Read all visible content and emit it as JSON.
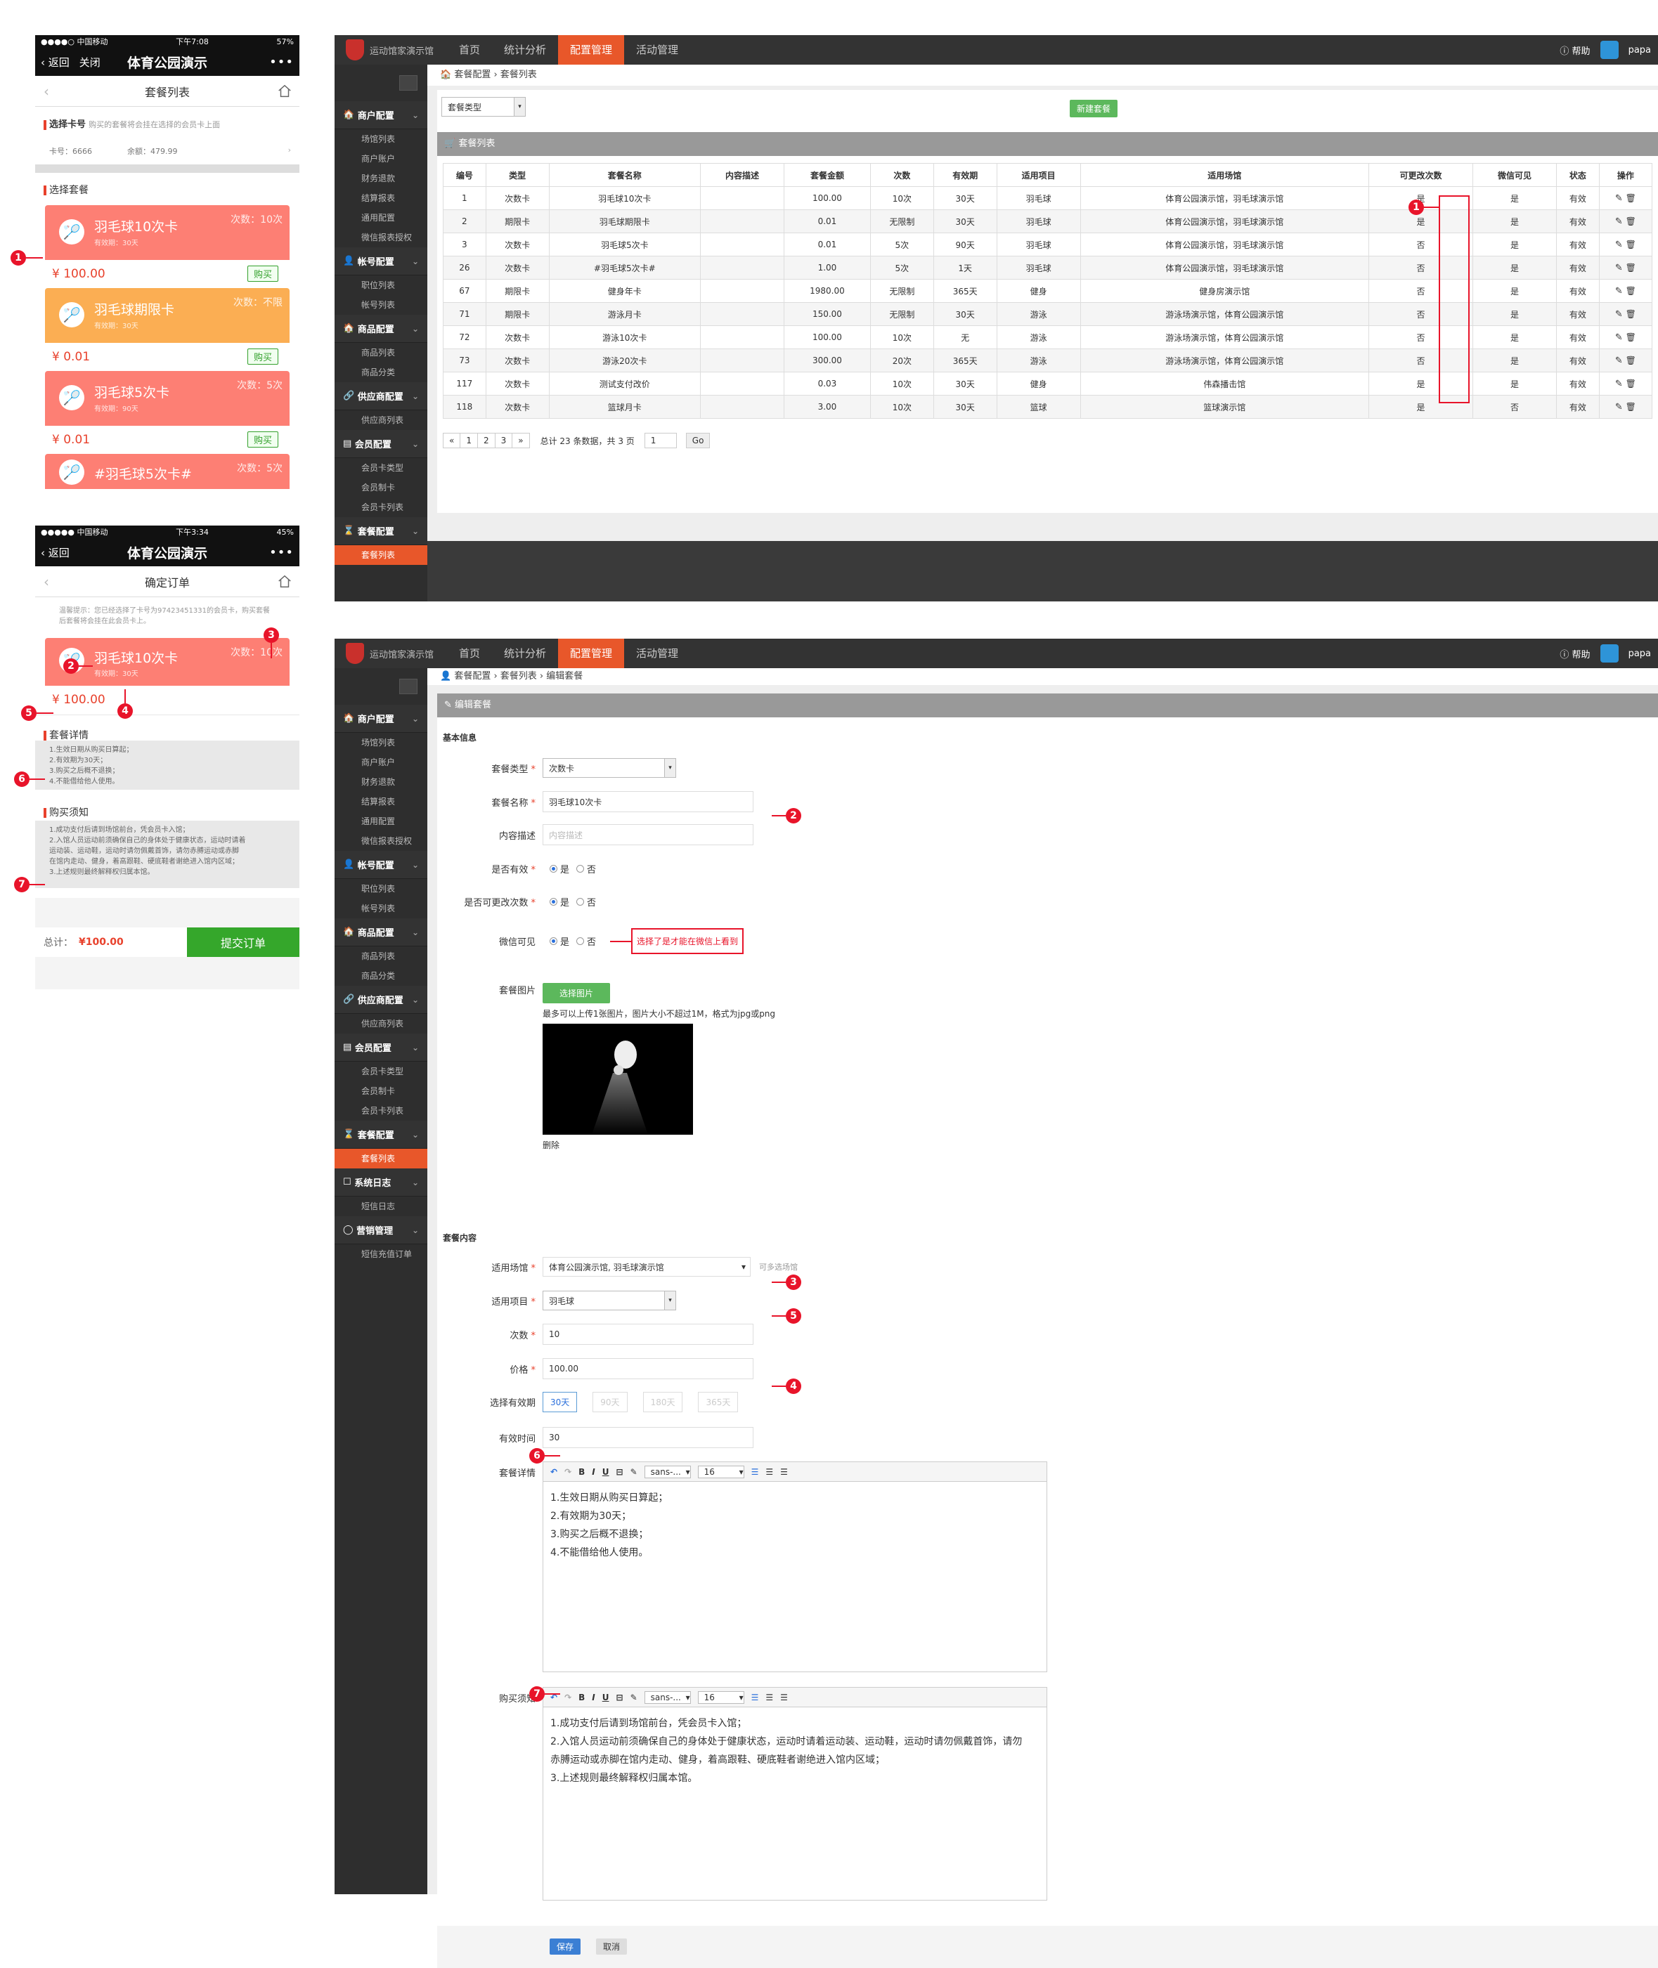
{
  "phone1": {
    "carrier": "●●●●○ 中国移动",
    "time": "下午7:08",
    "battery": "57%",
    "nav_back": "返回",
    "nav_close": "关闭",
    "nav_title": "体育公园演示",
    "nav_more": "•••",
    "sub_title": "套餐列表",
    "select_card_label": "选择卡号",
    "select_card_hint": "购买的套餐将会挂在选择的会员卡上面",
    "card_no": "卡号：6666",
    "balance": "余额：479.99",
    "select_package_label": "选择套餐",
    "cards": [
      {
        "name": "羽毛球10次卡",
        "validity": "有效期：30天",
        "count": "次数：10次",
        "price": "¥ 100.00",
        "buy": "购买",
        "color": "#fd7f74"
      },
      {
        "name": "羽毛球期限卡",
        "validity": "有效期：30天",
        "count": "次数：不限",
        "price": "¥ 0.01",
        "buy": "购买",
        "color": "#fbae53"
      },
      {
        "name": "羽毛球5次卡",
        "validity": "有效期：90天",
        "count": "次数：5次",
        "price": "¥ 0.01",
        "buy": "购买",
        "color": "#fd7f74"
      },
      {
        "name": "#羽毛球5次卡#",
        "validity": "",
        "count": "次数：5次",
        "price": "",
        "buy": "",
        "color": "#fd7f74"
      }
    ]
  },
  "phone2": {
    "carrier": "●●●●● 中国移动",
    "time": "下午3:34",
    "battery": "45%",
    "nav_back": "返回",
    "nav_title": "体育公园演示",
    "nav_more": "•••",
    "sub_title": "确定订单",
    "tip": "温馨提示：您已经选择了卡号为97423451331的会员卡，购买套餐后套餐将会挂在此会员卡上。",
    "card_name": "羽毛球10次卡",
    "card_validity": "有效期：30天",
    "card_count": "次数：10次",
    "price": "¥ 100.00",
    "detail_label": "套餐详情",
    "detail_lines": [
      "1.生效日期从购买日算起；",
      "2.有效期为30天；",
      "3.购买之后概不退换；",
      "4.不能借给他人使用。"
    ],
    "notice_label": "购买须知",
    "notice_lines": [
      "1.成功支付后请到场馆前台，凭会员卡入馆；",
      "2.入馆人员运动前须确保自己的身体处于健康状态，运动时请着",
      "运动装、运动鞋，运动时请勿佩戴首饰，请勿赤膊运动或赤脚",
      "在馆内走动、健身，着高跟鞋、硬底鞋者谢绝进入馆内区域；",
      "3.上述规则最终解释权归属本馆。"
    ],
    "total_label": "总计：",
    "total_value": "¥100.00",
    "submit": "提交订单"
  },
  "admin": {
    "logo_text": "运动馆家演示馆",
    "nav": [
      "首页",
      "统计分析",
      "配置管理",
      "活动管理"
    ],
    "help": "帮助",
    "user": "papa",
    "side_groups": [
      {
        "label": "商户配置",
        "items": [
          "场馆列表",
          "商户账户",
          "财务退款",
          "结算报表",
          "通用配置",
          "微信报表授权"
        ]
      },
      {
        "label": "帐号配置",
        "items": [
          "职位列表",
          "帐号列表"
        ]
      },
      {
        "label": "商品配置",
        "items": [
          "商品列表",
          "商品分类"
        ]
      },
      {
        "label": "供应商配置",
        "items": [
          "供应商列表"
        ]
      },
      {
        "label": "会员配置",
        "items": [
          "会员卡类型",
          "会员制卡",
          "会员卡列表"
        ]
      },
      {
        "label": "套餐配置",
        "items": [
          "套餐列表"
        ]
      },
      {
        "label": "系统日志",
        "items": [
          "短信日志"
        ]
      },
      {
        "label": "营销管理",
        "items": [
          "短信充值订单"
        ]
      }
    ]
  },
  "list_page": {
    "breadcrumb": "套餐配置 › 套餐列表",
    "filter_placeholder": "套餐类型",
    "new_button": "新建套餐",
    "panel_title": "套餐列表",
    "columns": [
      "编号",
      "类型",
      "套餐名称",
      "内容描述",
      "套餐金额",
      "次数",
      "有效期",
      "适用项目",
      "适用场馆",
      "可更改次数",
      "微信可见",
      "状态",
      "操作"
    ],
    "rows": [
      [
        "1",
        "次数卡",
        "羽毛球10次卡",
        "",
        "100.00",
        "10次",
        "30天",
        "羽毛球",
        "体育公园演示馆，羽毛球演示馆",
        "是",
        "是",
        "有效"
      ],
      [
        "2",
        "期限卡",
        "羽毛球期限卡",
        "",
        "0.01",
        "无限制",
        "30天",
        "羽毛球",
        "体育公园演示馆，羽毛球演示馆",
        "是",
        "是",
        "有效"
      ],
      [
        "3",
        "次数卡",
        "羽毛球5次卡",
        "",
        "0.01",
        "5次",
        "90天",
        "羽毛球",
        "体育公园演示馆，羽毛球演示馆",
        "否",
        "是",
        "有效"
      ],
      [
        "26",
        "次数卡",
        "#羽毛球5次卡#",
        "",
        "1.00",
        "5次",
        "1天",
        "羽毛球",
        "体育公园演示馆，羽毛球演示馆",
        "否",
        "是",
        "有效"
      ],
      [
        "67",
        "期限卡",
        "健身年卡",
        "",
        "1980.00",
        "无限制",
        "365天",
        "健身",
        "健身房演示馆",
        "否",
        "是",
        "有效"
      ],
      [
        "71",
        "期限卡",
        "游泳月卡",
        "",
        "150.00",
        "无限制",
        "30天",
        "游泳",
        "游泳场演示馆，体育公园演示馆",
        "否",
        "是",
        "有效"
      ],
      [
        "72",
        "次数卡",
        "游泳10次卡",
        "",
        "100.00",
        "10次",
        "无",
        "游泳",
        "游泳场演示馆，体育公园演示馆",
        "否",
        "是",
        "有效"
      ],
      [
        "73",
        "次数卡",
        "游泳20次卡",
        "",
        "300.00",
        "20次",
        "365天",
        "游泳",
        "游泳场演示馆，体育公园演示馆",
        "否",
        "是",
        "有效"
      ],
      [
        "117",
        "次数卡",
        "测试支付改价",
        "",
        "0.03",
        "10次",
        "30天",
        "健身",
        "伟森播击馆",
        "是",
        "是",
        "有效"
      ],
      [
        "118",
        "次数卡",
        "篮球月卡",
        "",
        "3.00",
        "10次",
        "30天",
        "篮球",
        "篮球演示馆",
        "是",
        "否",
        "有效"
      ]
    ],
    "pager": [
      "«",
      "1",
      "2",
      "3",
      "»"
    ],
    "total_text": "总计 23 条数据，共 3 页",
    "page_input": "1",
    "go": "Go"
  },
  "edit_page": {
    "breadcrumb": "套餐配置 › 套餐列表 › 编辑套餐",
    "panel_title": "编辑套餐",
    "basic_info": "基本信息",
    "type_label": "套餐类型",
    "type_value": "次数卡",
    "name_label": "套餐名称",
    "name_value": "羽毛球10次卡",
    "desc_label": "内容描述",
    "desc_placeholder": "内容描述",
    "valid_label": "是否有效",
    "change_label": "是否可更改次数",
    "wechat_label": "微信可见",
    "yes": "是",
    "no": "否",
    "wechat_callout": "选择了是才能在微信上看到",
    "image_label": "套餐图片",
    "image_button": "选择图片",
    "image_hint": "最多可以上传1张图片，图片大小不超过1M，格式为jpg或png",
    "delete": "删除",
    "content_section": "套餐内容",
    "venue_label": "适用场馆",
    "venue_value": "体育公园演示馆, 羽毛球演示馆",
    "venue_hint": "可多选场馆",
    "item_label": "适用项目",
    "item_value": "羽毛球",
    "count_label": "次数",
    "count_value": "10",
    "price_label": "价格",
    "price_value": "100.00",
    "period_label": "选择有效期",
    "periods": [
      "30天",
      "90天",
      "180天",
      "365天"
    ],
    "validtime_label": "有效时间",
    "validtime_value": "30",
    "detail_label": "套餐详情",
    "detail_lines": [
      "1.生效日期从购买日算起；",
      "2.有效期为30天；",
      "3.购买之后概不退换；",
      "4.不能借给他人使用。"
    ],
    "notice_label": "购买须知",
    "notice_lines": [
      "1.成功支付后请到场馆前台，凭会员卡入馆；",
      "2.入馆人员运动前须确保自己的身体处于健康状态，运动时请着运动装、运动鞋，运动时请勿佩戴首饰，请勿",
      "赤膊运动或赤脚在馆内走动、健身，着高跟鞋、硬底鞋者谢绝进入馆内区域；",
      "3.上述规则最终解释权归属本馆。"
    ],
    "font_family": "sans-...",
    "font_size": "16",
    "save": "保存",
    "cancel": "取消"
  },
  "markers": [
    "1",
    "2",
    "3",
    "4",
    "5",
    "6",
    "7"
  ]
}
